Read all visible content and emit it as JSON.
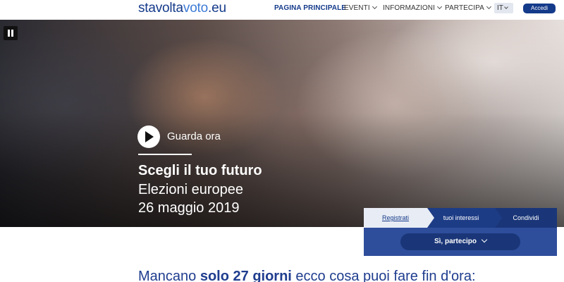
{
  "header": {
    "logo": {
      "part1": "stavolta",
      "part2": "voto",
      "part3": ".eu"
    },
    "nav": {
      "home": "PAGINA PRINCIPALE",
      "events": "EVENTI",
      "info": "INFORMAZIONI",
      "participate": "PARTECIPA"
    },
    "language": "IT",
    "login": "Accedi"
  },
  "hero": {
    "watch_label": "Guarda ora",
    "title": "Scegli il tuo futuro",
    "subtitle_line1": "Elezioni europee",
    "subtitle_line2": "26 maggio 2019"
  },
  "panel": {
    "steps": [
      "Registrati",
      "tuoi interessi",
      "Condividi"
    ],
    "cta": "Sì, partecipo"
  },
  "countdown": {
    "prefix": "Mancano ",
    "highlight": "solo 27 giorni",
    "suffix": " ecco cosa puoi fare fin d'ora:"
  },
  "colors": {
    "brand_dark": "#143a8a",
    "brand_light": "#3d7bd6",
    "panel": "#2e4d9b"
  }
}
